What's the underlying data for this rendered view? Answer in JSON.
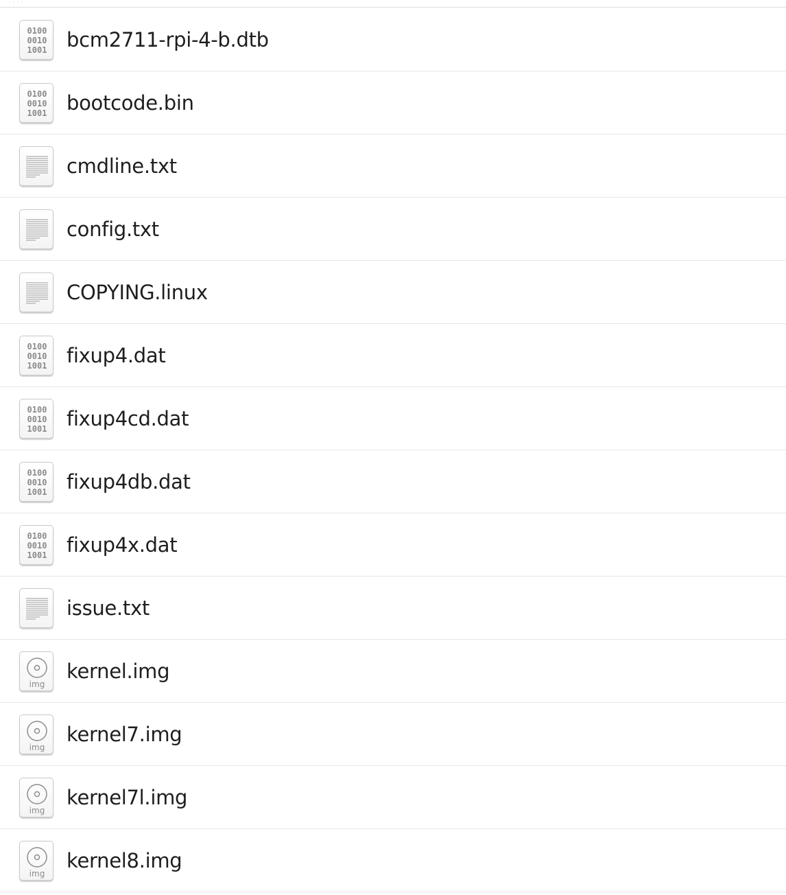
{
  "files": [
    {
      "name": "bcm2711-rpi-4-b.dtb",
      "icon": "binary-file-icon"
    },
    {
      "name": "bootcode.bin",
      "icon": "binary-file-icon"
    },
    {
      "name": "cmdline.txt",
      "icon": "text-file-icon"
    },
    {
      "name": "config.txt",
      "icon": "text-file-icon"
    },
    {
      "name": "COPYING.linux",
      "icon": "text-file-icon"
    },
    {
      "name": "fixup4.dat",
      "icon": "binary-file-icon"
    },
    {
      "name": "fixup4cd.dat",
      "icon": "binary-file-icon"
    },
    {
      "name": "fixup4db.dat",
      "icon": "binary-file-icon"
    },
    {
      "name": "fixup4x.dat",
      "icon": "binary-file-icon"
    },
    {
      "name": "issue.txt",
      "icon": "text-file-icon"
    },
    {
      "name": "kernel.img",
      "icon": "disk-image-icon"
    },
    {
      "name": "kernel7.img",
      "icon": "disk-image-icon"
    },
    {
      "name": "kernel7l.img",
      "icon": "disk-image-icon"
    },
    {
      "name": "kernel8.img",
      "icon": "disk-image-icon"
    }
  ],
  "binary_glyph_lines": [
    "0100",
    "0010",
    "1001"
  ],
  "image_glyph_label": "img"
}
